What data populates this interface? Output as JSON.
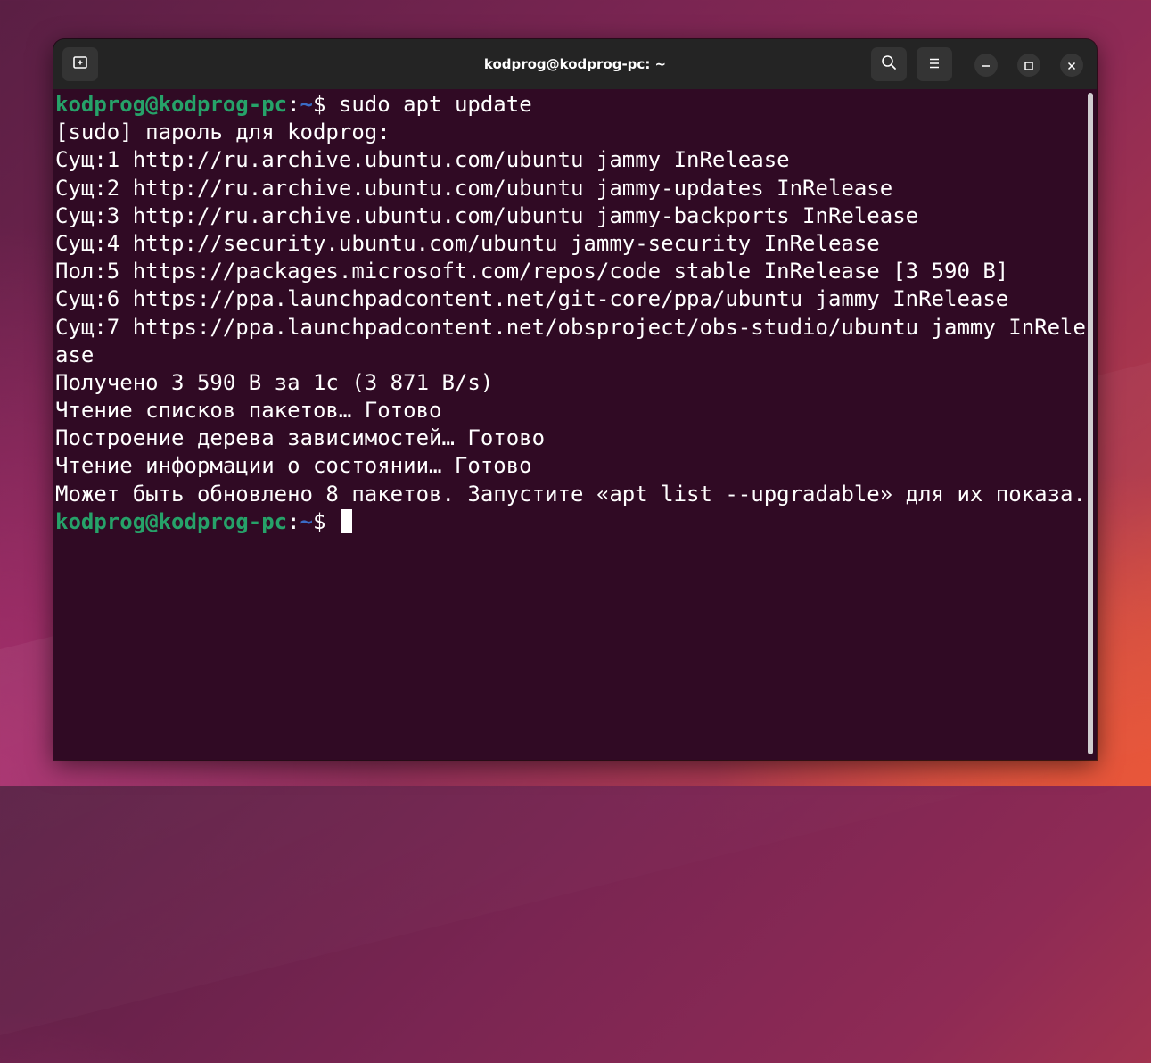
{
  "window": {
    "title": "kodprog@kodprog-pc: ~"
  },
  "icons": {
    "new_tab": "new-tab-icon",
    "search": "search-icon",
    "menu": "hamburger-menu-icon",
    "minimize": "minimize-icon",
    "maximize": "maximize-icon",
    "close": "close-icon"
  },
  "colors": {
    "terminal_bg": "#300a24",
    "prompt_user": "#26a269",
    "prompt_path": "#3a6bc4",
    "text": "#ffffff",
    "titlebar": "#242424"
  },
  "terminal": {
    "prompt_user": "kodprog@kodprog-pc",
    "prompt_colon": ":",
    "prompt_path": "~",
    "prompt_symbol": "$ ",
    "command": "sudo apt update",
    "output": [
      "[sudo] пароль для kodprog:",
      "Сущ:1 http://ru.archive.ubuntu.com/ubuntu jammy InRelease",
      "Сущ:2 http://ru.archive.ubuntu.com/ubuntu jammy-updates InRelease",
      "Сущ:3 http://ru.archive.ubuntu.com/ubuntu jammy-backports InRelease",
      "Сущ:4 http://security.ubuntu.com/ubuntu jammy-security InRelease",
      "Пол:5 https://packages.microsoft.com/repos/code stable InRelease [3 590 B]",
      "Сущ:6 https://ppa.launchpadcontent.net/git-core/ppa/ubuntu jammy InRelease",
      "Сущ:7 https://ppa.launchpadcontent.net/obsproject/obs-studio/ubuntu jammy InRele",
      "ase",
      "Получено 3 590 B за 1с (3 871 B/s)",
      "Чтение списков пакетов… Готово",
      "Построение дерева зависимостей… Готово",
      "Чтение информации о состоянии… Готово",
      "Может быть обновлено 8 пакетов. Запустите «apt list --upgradable» для их показа."
    ]
  }
}
